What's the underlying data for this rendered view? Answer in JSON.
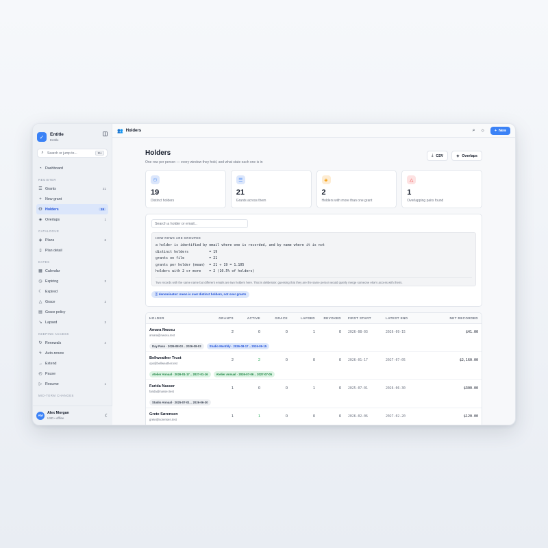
{
  "app": {
    "name": "Entitle",
    "subtitle": "Entitle"
  },
  "search": {
    "placeholder": "Search or jump to...",
    "shortcut": "⌘K"
  },
  "sidebar": {
    "dashboard": "Dashboard",
    "sections": {
      "register": "REGISTER",
      "catalogue": "CATALOGUE",
      "dates": "DATES",
      "keeping_access": "KEEPING ACCESS",
      "mid_term": "MID-TERM CHANGES"
    },
    "register": [
      {
        "label": "Grants",
        "count": "21"
      },
      {
        "label": "New grant",
        "count": ""
      },
      {
        "label": "Holders",
        "count": "19"
      },
      {
        "label": "Overlaps",
        "count": "1"
      }
    ],
    "catalogue": [
      {
        "label": "Plans",
        "count": "6"
      },
      {
        "label": "Plan detail",
        "count": ""
      }
    ],
    "dates": [
      {
        "label": "Calendar",
        "count": ""
      },
      {
        "label": "Expiring",
        "count": "3"
      },
      {
        "label": "Expired",
        "count": ""
      },
      {
        "label": "Grace",
        "count": "2"
      },
      {
        "label": "Grace policy",
        "count": ""
      },
      {
        "label": "Lapsed",
        "count": "3"
      }
    ],
    "keeping_access": [
      {
        "label": "Renewals",
        "count": "4"
      },
      {
        "label": "Auto-renew",
        "count": ""
      },
      {
        "label": "Extend",
        "count": ""
      },
      {
        "label": "Pause",
        "count": ""
      },
      {
        "label": "Resume",
        "count": "1"
      }
    ]
  },
  "user": {
    "initials": "AM",
    "name": "Alex Morgan",
    "meta": "USD • offline"
  },
  "topbar": {
    "title": "Holders",
    "new_label": "New"
  },
  "page": {
    "title": "Holders",
    "subtitle": "One row per person — every window they hold, and what state each one is in",
    "csv_label": "CSV",
    "overlaps_label": "Overlaps"
  },
  "cards": [
    {
      "value": "19",
      "label": "Distinct holders",
      "icon": "users-icon",
      "color": "#3b82f6"
    },
    {
      "value": "21",
      "label": "Grants across them",
      "icon": "list-icon",
      "color": "#3b82f6"
    },
    {
      "value": "2",
      "label": "Holders with more than one grant",
      "icon": "layers-icon",
      "color": "#f59e0b"
    },
    {
      "value": "1",
      "label": "Overlapping pairs found",
      "icon": "warning-icon",
      "color": "#ef4444"
    }
  ],
  "grouping": {
    "search_placeholder": "Search a holder or email...",
    "heading": "HOW ROWS ARE GROUPED",
    "lines": [
      "a holder is identified by email where one is recorded, and by name where it is not",
      "distinct holders          = 19",
      "grants on file            = 21",
      "grants per holder (mean)  = 21 ÷ 19 = 1.105",
      "holders with 2 or more    = 2 (10.5% of holders)"
    ],
    "note": "Two records with the same name but different emails are two holders here. That is deliberate: guessing that they are the same person would quietly merge someone else's access with theirs.",
    "pill": "denominator: mean is over distinct holders, not over grants"
  },
  "table": {
    "headers": [
      "HOLDER",
      "GRANTS",
      "ACTIVE",
      "GRACE",
      "LAPSED",
      "REVOKED",
      "FIRST START",
      "LATEST END",
      "NET RECORDED"
    ],
    "rows": [
      {
        "name": "Amara Nwosu",
        "email": "amara@nwosu.test",
        "grants": "2",
        "active": "0",
        "grace": "0",
        "lapsed": "1",
        "revoked": "0",
        "first": "2026-08-03",
        "latest": "2026-09-15",
        "net": "$41.00",
        "tags": [
          {
            "text": "Day Pass · 2026-08-03 .. 2026-08-03",
            "style": "gray"
          },
          {
            "text": "Studio Monthly · 2026-08-17 .. 2026-09-15",
            "style": "blue"
          }
        ]
      },
      {
        "name": "Bellweather Trust",
        "email": "ops@bellweather.test",
        "grants": "2",
        "active": "2",
        "grace": "0",
        "lapsed": "0",
        "revoked": "0",
        "first": "2026-01-17",
        "latest": "2027-07-05",
        "net": "$2,160.00",
        "tags": [
          {
            "text": "Atelier Annual · 2026-01-17 .. 2027-01-16",
            "style": "green"
          },
          {
            "text": "Atelier Annual · 2026-07-06 .. 2027-07-05",
            "style": "green"
          }
        ]
      },
      {
        "name": "Farida Nasser",
        "email": "farida@nasser.test",
        "grants": "1",
        "active": "0",
        "grace": "0",
        "lapsed": "1",
        "revoked": "0",
        "first": "2025-07-01",
        "latest": "2026-06-30",
        "net": "$300.00",
        "tags": [
          {
            "text": "Studio Annual · 2025-07-01 .. 2026-06-30",
            "style": "gray"
          }
        ]
      },
      {
        "name": "Grete Sørensen",
        "email": "grete@sorensen.test",
        "grants": "1",
        "active": "1",
        "grace": "0",
        "lapsed": "0",
        "revoked": "0",
        "first": "2026-02-06",
        "latest": "2027-02-20",
        "net": "$120.00",
        "tags": []
      }
    ]
  }
}
